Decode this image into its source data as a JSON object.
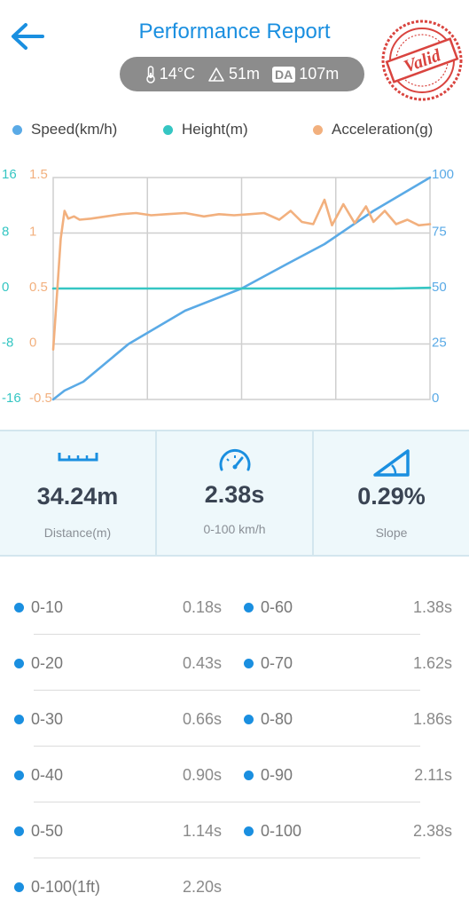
{
  "header": {
    "title": "Performance Report",
    "back_icon": "back-arrow-icon",
    "stamp_text": "Valid",
    "env": {
      "temperature": "14°C",
      "altitude": "51m",
      "da_badge": "DA",
      "density_altitude": "107m"
    }
  },
  "legend": [
    {
      "label": "Speed(km/h)",
      "color": "#5aaae6"
    },
    {
      "label": "Height(m)",
      "color": "#35c6c3"
    },
    {
      "label": "Acceleration(g)",
      "color": "#f2b07e"
    }
  ],
  "chart_data": {
    "type": "line",
    "height_axis": {
      "ticks": [
        "16",
        "8",
        "0",
        "-8",
        "-16"
      ],
      "range": [
        -16,
        16
      ],
      "color": "#35c6c3"
    },
    "accel_axis": {
      "ticks": [
        "1.5",
        "1",
        "0.5",
        "0",
        "-0.5"
      ],
      "range": [
        -0.5,
        1.5
      ],
      "color": "#f2b07e"
    },
    "speed_axis": {
      "ticks": [
        "100",
        "75",
        "50",
        "25",
        "0"
      ],
      "range": [
        0,
        100
      ],
      "color": "#5aaae6"
    },
    "grid": true,
    "series": [
      {
        "name": "Speed(km/h)",
        "axis": "speed",
        "color": "#5aaae6",
        "x": [
          0,
          0.03,
          0.08,
          0.2,
          0.35,
          0.5,
          0.62,
          0.72,
          0.85,
          1.0
        ],
        "y": [
          0,
          4,
          8,
          25,
          40,
          50,
          61,
          70,
          85,
          100
        ]
      },
      {
        "name": "Height(m)",
        "axis": "height",
        "color": "#35c6c3",
        "x": [
          0,
          0.5,
          0.9,
          1.0
        ],
        "y": [
          0,
          0,
          0,
          0.1
        ]
      },
      {
        "name": "Acceleration(g)",
        "axis": "accel",
        "color": "#f2b07e",
        "x": [
          0,
          0.01,
          0.02,
          0.03,
          0.04,
          0.055,
          0.07,
          0.1,
          0.14,
          0.18,
          0.22,
          0.26,
          0.3,
          0.35,
          0.4,
          0.44,
          0.48,
          0.52,
          0.56,
          0.6,
          0.63,
          0.66,
          0.69,
          0.72,
          0.74,
          0.77,
          0.8,
          0.83,
          0.85,
          0.88,
          0.91,
          0.94,
          0.97,
          1.0
        ],
        "y": [
          -0.05,
          0.45,
          0.95,
          1.2,
          1.13,
          1.15,
          1.12,
          1.13,
          1.15,
          1.17,
          1.18,
          1.16,
          1.17,
          1.18,
          1.15,
          1.17,
          1.16,
          1.17,
          1.18,
          1.12,
          1.2,
          1.1,
          1.08,
          1.3,
          1.07,
          1.26,
          1.09,
          1.24,
          1.1,
          1.2,
          1.08,
          1.12,
          1.07,
          1.08
        ]
      }
    ]
  },
  "metrics": [
    {
      "value": "34.24m",
      "label": "Distance(m)",
      "icon": "ruler-icon"
    },
    {
      "value": "2.38s",
      "label": "0-100 km/h",
      "icon": "speedometer-icon"
    },
    {
      "value": "0.29%",
      "label": "Slope",
      "icon": "slope-icon"
    }
  ],
  "splits": [
    {
      "left": {
        "range": "0-10",
        "time": "0.18s"
      },
      "right": {
        "range": "0-60",
        "time": "1.38s"
      }
    },
    {
      "left": {
        "range": "0-20",
        "time": "0.43s"
      },
      "right": {
        "range": "0-70",
        "time": "1.62s"
      }
    },
    {
      "left": {
        "range": "0-30",
        "time": "0.66s"
      },
      "right": {
        "range": "0-80",
        "time": "1.86s"
      }
    },
    {
      "left": {
        "range": "0-40",
        "time": "0.90s"
      },
      "right": {
        "range": "0-90",
        "time": "2.11s"
      }
    },
    {
      "left": {
        "range": "0-50",
        "time": "1.14s"
      },
      "right": {
        "range": "0-100",
        "time": "2.38s"
      }
    },
    {
      "left": {
        "range": "0-100(1ft)",
        "time": "2.20s"
      },
      "right": null
    }
  ]
}
